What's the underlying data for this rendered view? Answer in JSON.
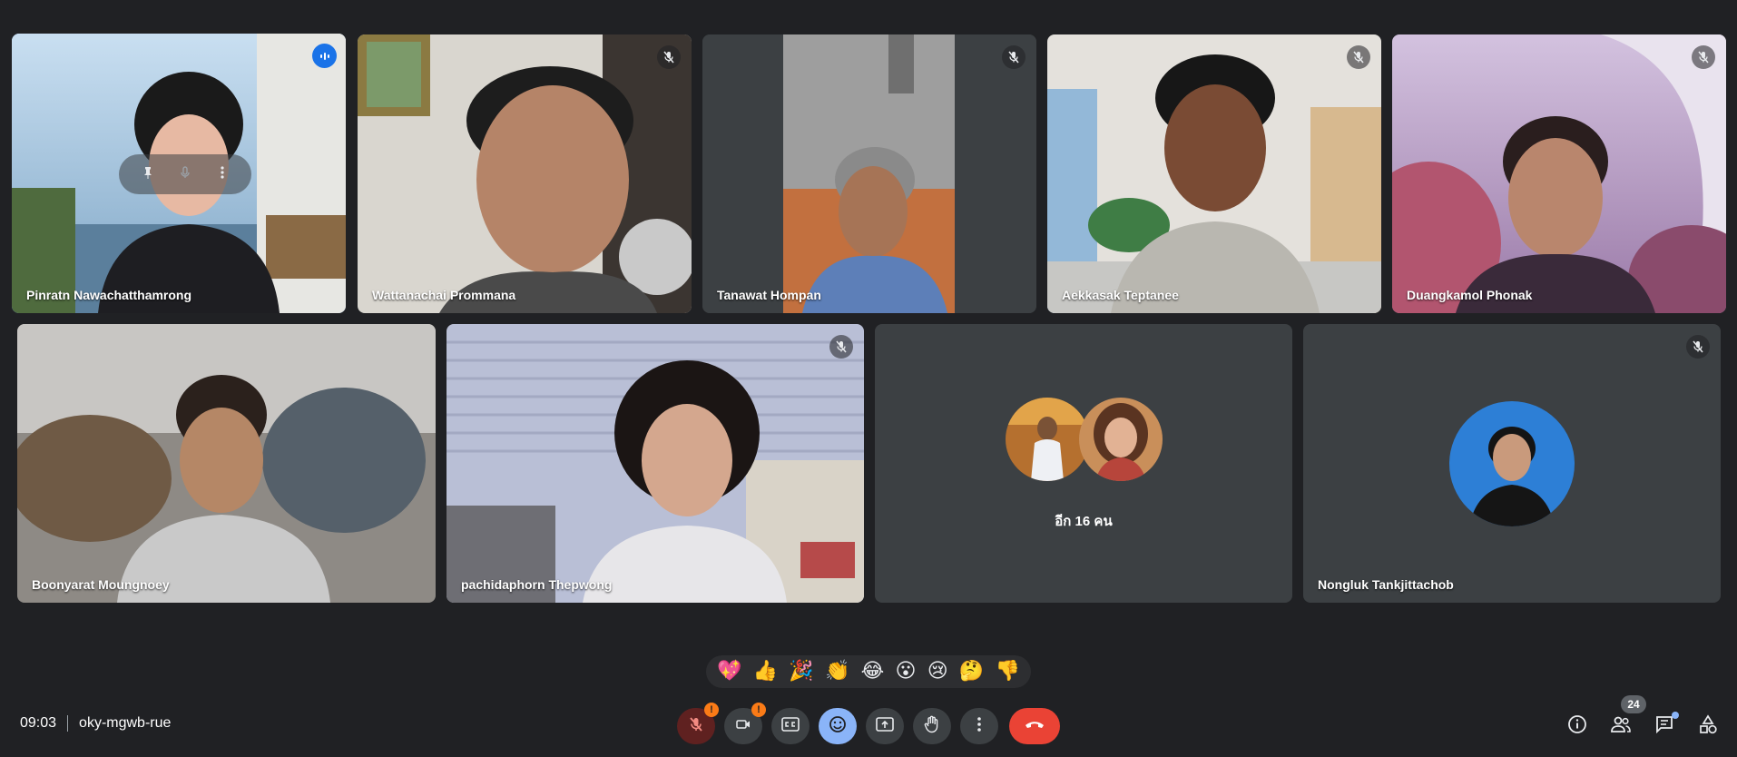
{
  "participants": [
    {
      "name": "Pinratn Nawachatthamrong",
      "status": "speaking",
      "pinned_controls": [
        "pin-icon",
        "mute-icon",
        "more-icon"
      ]
    },
    {
      "name": "Wattanachai Prommana",
      "status": "muted"
    },
    {
      "name": "Tanawat Hompan",
      "status": "muted"
    },
    {
      "name": "Aekkasak Teptanee",
      "status": "muted"
    },
    {
      "name": "Duangkamol Phonak",
      "status": "muted"
    },
    {
      "name": "Boonyarat Moungnoey",
      "status": "muted"
    },
    {
      "name": "pachidaphorn Thepwong",
      "status": "muted"
    },
    {
      "name": "Nongluk Tankjittachob",
      "status": "muted"
    }
  ],
  "others_tile": {
    "label": "อีก 16 คน"
  },
  "reactions": [
    "💖",
    "👍",
    "🎉",
    "👏",
    "😂",
    "😮",
    "😢",
    "🤔",
    "👎"
  ],
  "meeting": {
    "time": "09:03",
    "code": "oky-mgwb-rue"
  },
  "toolbar": {
    "mic_warning": "!",
    "camera_warning": "!",
    "participants_count": "24"
  },
  "colors": {
    "background": "#202124",
    "tile": "#3c4043",
    "accent": "#8ab4f8",
    "hangup": "#ea4335",
    "warning": "#fa7b17"
  }
}
